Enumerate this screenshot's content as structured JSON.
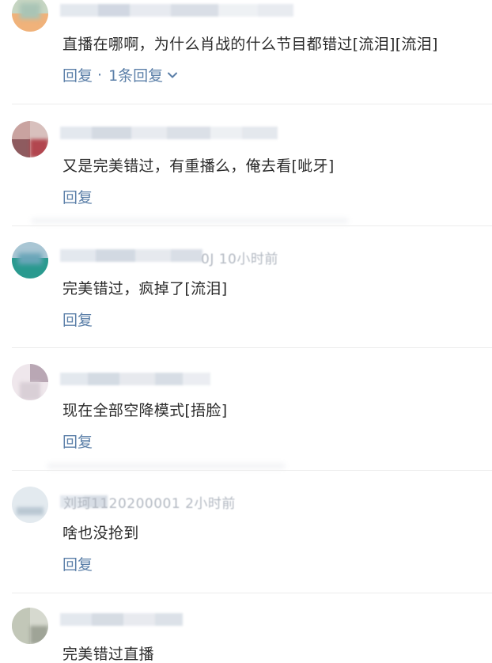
{
  "comments": [
    {
      "text": "直播在哪啊，为什么肖战的什么节目都错过[流泪][流泪]",
      "reply_label": "回复",
      "reply_sep": "·",
      "reply_count": "1条回复",
      "avatar_colors": [
        "#c7d6c3",
        "#a9c4b5",
        "#e7a96b",
        "#f4c58f"
      ]
    },
    {
      "text": "又是完美错过，有重播么，俺去看[呲牙]",
      "reply_label": "回复",
      "avatar_colors": [
        "#c9a3a0",
        "#8e5b5f",
        "#d8c0bd",
        "#b2464f"
      ]
    },
    {
      "meta": "0J 10小时前",
      "text": "完美错过，疯掉了[流泪]",
      "reply_label": "回复",
      "avatar_colors": [
        "#a9c6d4",
        "#6aa5b8",
        "#4db3a8",
        "#2a9a8f"
      ]
    },
    {
      "text": "现在全部空降模式[捂脸]",
      "reply_label": "回复",
      "avatar_colors": [
        "#d9cfd6",
        "#b9a7b4",
        "#efe7ec",
        "#c9bcc6"
      ]
    },
    {
      "meta": "刘珂1120200001 2小时前",
      "text": "啥也没抢到",
      "reply_label": "回复",
      "avatar_colors": [
        "#e3eaef",
        "#cfdbe3",
        "#dbe5ec",
        "#b9c7d2"
      ]
    },
    {
      "text": "完美错过直播",
      "avatar_colors": [
        "#c2c7b8",
        "#9fa497",
        "#d6d9cf",
        "#8f9487"
      ]
    }
  ],
  "colors": {
    "text": "#2b2b2b",
    "link": "#5b7fa8",
    "meta": "#b3b9c2",
    "divider": "#ececec"
  }
}
